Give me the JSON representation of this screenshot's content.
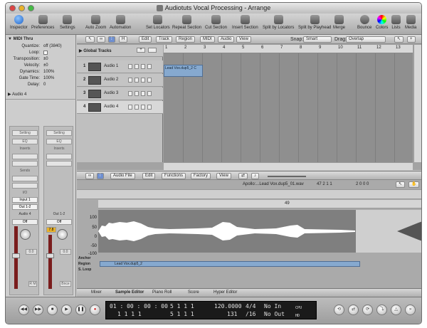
{
  "window": {
    "title": "Audiotuts Vocal Processing - Arrange"
  },
  "toolbar": {
    "items": [
      "Inspector",
      "Preferences",
      "Settings",
      "Auto Zoom",
      "Automation",
      "Set Locators",
      "Repeat Section",
      "Cut Section",
      "Insert Section",
      "Split by Locators",
      "Split by Playhead",
      "Merge",
      "Bounce",
      "Colors",
      "Lists",
      "Media"
    ]
  },
  "inspector": {
    "header": "MIDI Thru",
    "params": [
      {
        "k": "Quantize:",
        "v": "off (3840)"
      },
      {
        "k": "Loop:",
        "v": ""
      },
      {
        "k": "Transposition:",
        "v": "±0"
      },
      {
        "k": "Velocity:",
        "v": "±0"
      },
      {
        "k": "Dynamics:",
        "v": "100%"
      },
      {
        "k": "Gate Time:",
        "v": "100%"
      },
      {
        "k": "Delay:",
        "v": "0"
      }
    ],
    "audio_header": "Audio 4",
    "strip1": {
      "setting": "Setting",
      "eq": "EQ",
      "inserts": "Inserts",
      "sends": "Sends",
      "io": "I/O",
      "input": "Input 1",
      "output": "Out 1-2",
      "name": "Audio 4",
      "mode": "Off",
      "level": "0.0",
      "rm": "R M"
    },
    "strip2": {
      "setting": "Setting",
      "eq": "EQ",
      "inserts": "Inserts",
      "output": "Out 1-2",
      "mode": "Off",
      "peak": "7.8",
      "level": "0.0",
      "bnce": "Bnce"
    }
  },
  "arrange": {
    "menus": [
      "Edit",
      "Track",
      "Region",
      "MIDI",
      "Audio",
      "View"
    ],
    "snap_label": "Snap:",
    "snap": "Smart",
    "drag_label": "Drag:",
    "drag": "Overlap",
    "global_tracks": "Global Tracks",
    "ruler": [
      "1",
      "2",
      "3",
      "4",
      "5",
      "6",
      "7",
      "8",
      "9",
      "10",
      "11",
      "12",
      "13"
    ],
    "tracks": [
      {
        "num": "1",
        "name": "Audio 1"
      },
      {
        "num": "2",
        "name": "Audio 2"
      },
      {
        "num": "3",
        "name": "Audio 3"
      },
      {
        "num": "4",
        "name": "Audio 4"
      }
    ],
    "region": "Lead Vox.dup5_2 C"
  },
  "editor": {
    "menus": [
      "Audio File",
      "Edit",
      "Functions",
      "Factory",
      "View"
    ],
    "file": "Apollo:...Lead Vox.dup5_01.wav",
    "position": "47  2  1    1",
    "length": "2  0  0    0",
    "marker": "49",
    "yticks": [
      "100",
      "50",
      "0",
      "-50",
      "-100"
    ],
    "rows": [
      "Anchor",
      "Region",
      "S. Loop"
    ],
    "region_name": "Lead Vox.dup5_2",
    "tabs": [
      "Mixer",
      "Sample Editor",
      "Piano Roll",
      "Score",
      "Hyper Editor"
    ]
  },
  "transport": {
    "time": "01 : 00 : 00 : 00",
    "bars_top": "1    1    1    1",
    "bars_bottom": "1    1    1    1",
    "pos2_top": "5    1    1    1",
    "pos2_bottom": "5    1    1    1",
    "tempo": "120.0000",
    "div": "131",
    "sig": "4/4",
    "sig2": "/16",
    "in": "No In",
    "out": "No Out",
    "cpu": "CPU",
    "hd": "HD"
  }
}
